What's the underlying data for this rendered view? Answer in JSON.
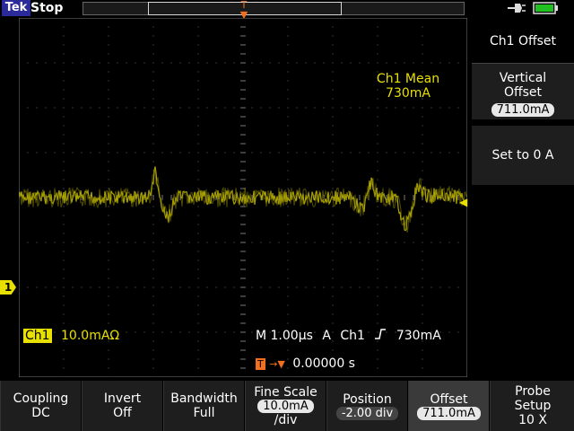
{
  "top": {
    "brand": "Tek",
    "run_status": "Stop",
    "trigger_marker": "T"
  },
  "colors": {
    "ch1": "#e8e000",
    "trigger": "#f07020",
    "brand": "#2a2a9a",
    "battery": "#20c020"
  },
  "display": {
    "measurement_label": "Ch1 Mean",
    "measurement_value": "730mA",
    "ch1_label": "Ch1",
    "ch1_scale": "10.0mAΩ",
    "timebase": "M 1.00µs",
    "acq_mode": "A",
    "trigger_source": "Ch1",
    "trigger_slope_icon": "rising-edge-icon",
    "trigger_level": "730mA",
    "trigger_delay_marker": "T",
    "trigger_delay": "0.00000 s",
    "ch1_marker": "1"
  },
  "side_menu": {
    "title": "Ch1 Offset",
    "vertical_offset_label_line1": "Vertical",
    "vertical_offset_label_line2": "Offset",
    "vertical_offset_value": "711.0mA",
    "set_zero_label": "Set to 0 A"
  },
  "bottom_menu": [
    {
      "line1": "Coupling",
      "line2": "DC"
    },
    {
      "line1": "Invert",
      "line2": "Off"
    },
    {
      "line1": "Bandwidth",
      "line2": "Full"
    },
    {
      "line1": "Fine Scale",
      "line2": "10.0mA",
      "line3": "/div"
    },
    {
      "line1": "Position",
      "line2": "-2.00 div"
    },
    {
      "line1": "Offset",
      "line2": "711.0mA"
    },
    {
      "line1": "Probe",
      "line2": "Setup",
      "line3": "10 X"
    }
  ]
}
